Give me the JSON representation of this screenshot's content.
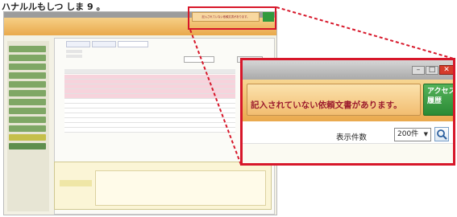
{
  "caption": "ハナルルもしつ しま 9 。",
  "small_app": {
    "alert_text": "記入されていない依頼文書があります。",
    "access_label": "アクセス履歴"
  },
  "zoom": {
    "alert_text": "記入されていない依頼文書があります。",
    "access_label": "アクセス\n履歴",
    "count_label": "表示件数",
    "count_value": "200件",
    "window_buttons": [
      "–",
      "□",
      "✕"
    ]
  },
  "colors": {
    "highlight": "#d7172a",
    "alert_text": "#9c1c2e",
    "access_green": "#2f9a3e",
    "band_orange": "#eaa94e"
  },
  "icons": [
    "search-icon",
    "dropdown-arrow-icon",
    "minimize-icon",
    "maximize-icon",
    "close-icon"
  ]
}
